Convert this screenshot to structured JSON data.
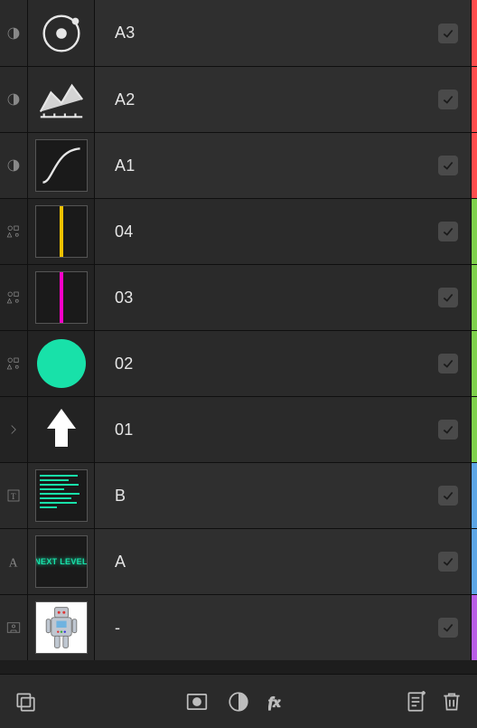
{
  "colors": {
    "red": "#ff4d4d",
    "green": "#7fd14d",
    "blue": "#5da6e6",
    "purple": "#b95ee6"
  },
  "layers": [
    {
      "id": "a3",
      "label": "A3",
      "checked": true,
      "tag": "#ff4d4d",
      "left_icon": "adjustment",
      "thumb": "orbit"
    },
    {
      "id": "a2",
      "label": "A2",
      "checked": true,
      "tag": "#ff4d4d",
      "left_icon": "adjustment",
      "thumb": "area"
    },
    {
      "id": "a1",
      "label": "A1",
      "checked": true,
      "tag": "#ff4d4d",
      "left_icon": "adjustment",
      "thumb": "curve"
    },
    {
      "id": "04",
      "label": "04",
      "checked": true,
      "tag": "#7fd14d",
      "left_icon": "shapes",
      "thumb": "line_yellow",
      "dark": true
    },
    {
      "id": "03",
      "label": "03",
      "checked": true,
      "tag": "#7fd14d",
      "left_icon": "shapes",
      "thumb": "line_magenta",
      "dark": true
    },
    {
      "id": "02",
      "label": "02",
      "checked": true,
      "tag": "#7fd14d",
      "left_icon": "shapes",
      "thumb": "circle_teal",
      "dark": true
    },
    {
      "id": "01",
      "label": "01",
      "checked": true,
      "tag": "#7fd14d",
      "left_icon": "chevron",
      "thumb": "arrow_up",
      "dark": true
    },
    {
      "id": "b",
      "label": "B",
      "checked": true,
      "tag": "#5da6e6",
      "left_icon": "textframe",
      "thumb": "text_lines"
    },
    {
      "id": "a",
      "label": "A",
      "checked": true,
      "tag": "#5da6e6",
      "left_icon": "artistic_text",
      "thumb": "next_level",
      "thumb_text": "NEXT LEVEL"
    },
    {
      "id": "dash",
      "label": "-",
      "checked": true,
      "tag": "#b95ee6",
      "left_icon": "image",
      "thumb": "robot"
    }
  ],
  "toolbar": {
    "left": [
      "layers-button"
    ],
    "center": [
      "mask-button",
      "adjustment-button",
      "fx-button"
    ],
    "right": [
      "page-add-button",
      "delete-button"
    ]
  }
}
